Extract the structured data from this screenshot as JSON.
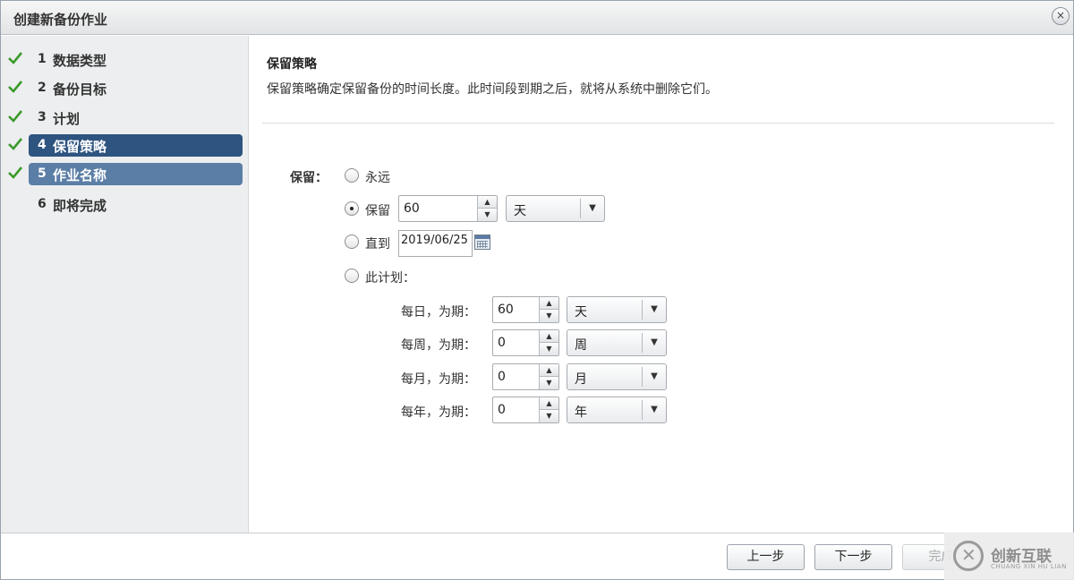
{
  "dialog": {
    "title": "创建新备份作业",
    "close_icon": "×"
  },
  "sidebar": {
    "steps": [
      {
        "num": "1",
        "label": "数据类型",
        "done": true
      },
      {
        "num": "2",
        "label": "备份目标",
        "done": true
      },
      {
        "num": "3",
        "label": "计划",
        "done": true
      },
      {
        "num": "4",
        "label": "保留策略",
        "done": true,
        "state": "active"
      },
      {
        "num": "5",
        "label": "作业名称",
        "done": true,
        "state": "current"
      },
      {
        "num": "6",
        "label": "即将完成",
        "done": false
      }
    ]
  },
  "main": {
    "section_title": "保留策略",
    "section_desc": "保留策略确定保留备份的时间长度。此时间段到期之后，就将从系统中删除它们。",
    "retain_label": "保留：",
    "options": {
      "forever": {
        "label": "永远",
        "selected": false
      },
      "keep": {
        "label": "保留",
        "selected": true,
        "value": "60",
        "unit": "天"
      },
      "until": {
        "label": "直到",
        "selected": false,
        "date": "2019/06/25"
      },
      "plan": {
        "label": "此计划：",
        "selected": false
      }
    },
    "plan_rows": [
      {
        "label": "每日，为期：",
        "value": "60",
        "unit": "天"
      },
      {
        "label": "每周，为期：",
        "value": "0",
        "unit": "周"
      },
      {
        "label": "每月，为期：",
        "value": "0",
        "unit": "月"
      },
      {
        "label": "每年，为期：",
        "value": "0",
        "unit": "年"
      }
    ]
  },
  "footer": {
    "prev": "上一步",
    "next": "下一步",
    "finish": "完成"
  },
  "watermark": {
    "text": "创新互联",
    "sub": "CHUANG XIN HU LIAN"
  },
  "colors": {
    "active_step": "#2e5480",
    "current_step": "#5b7ea6",
    "check": "#3a9a2a"
  }
}
